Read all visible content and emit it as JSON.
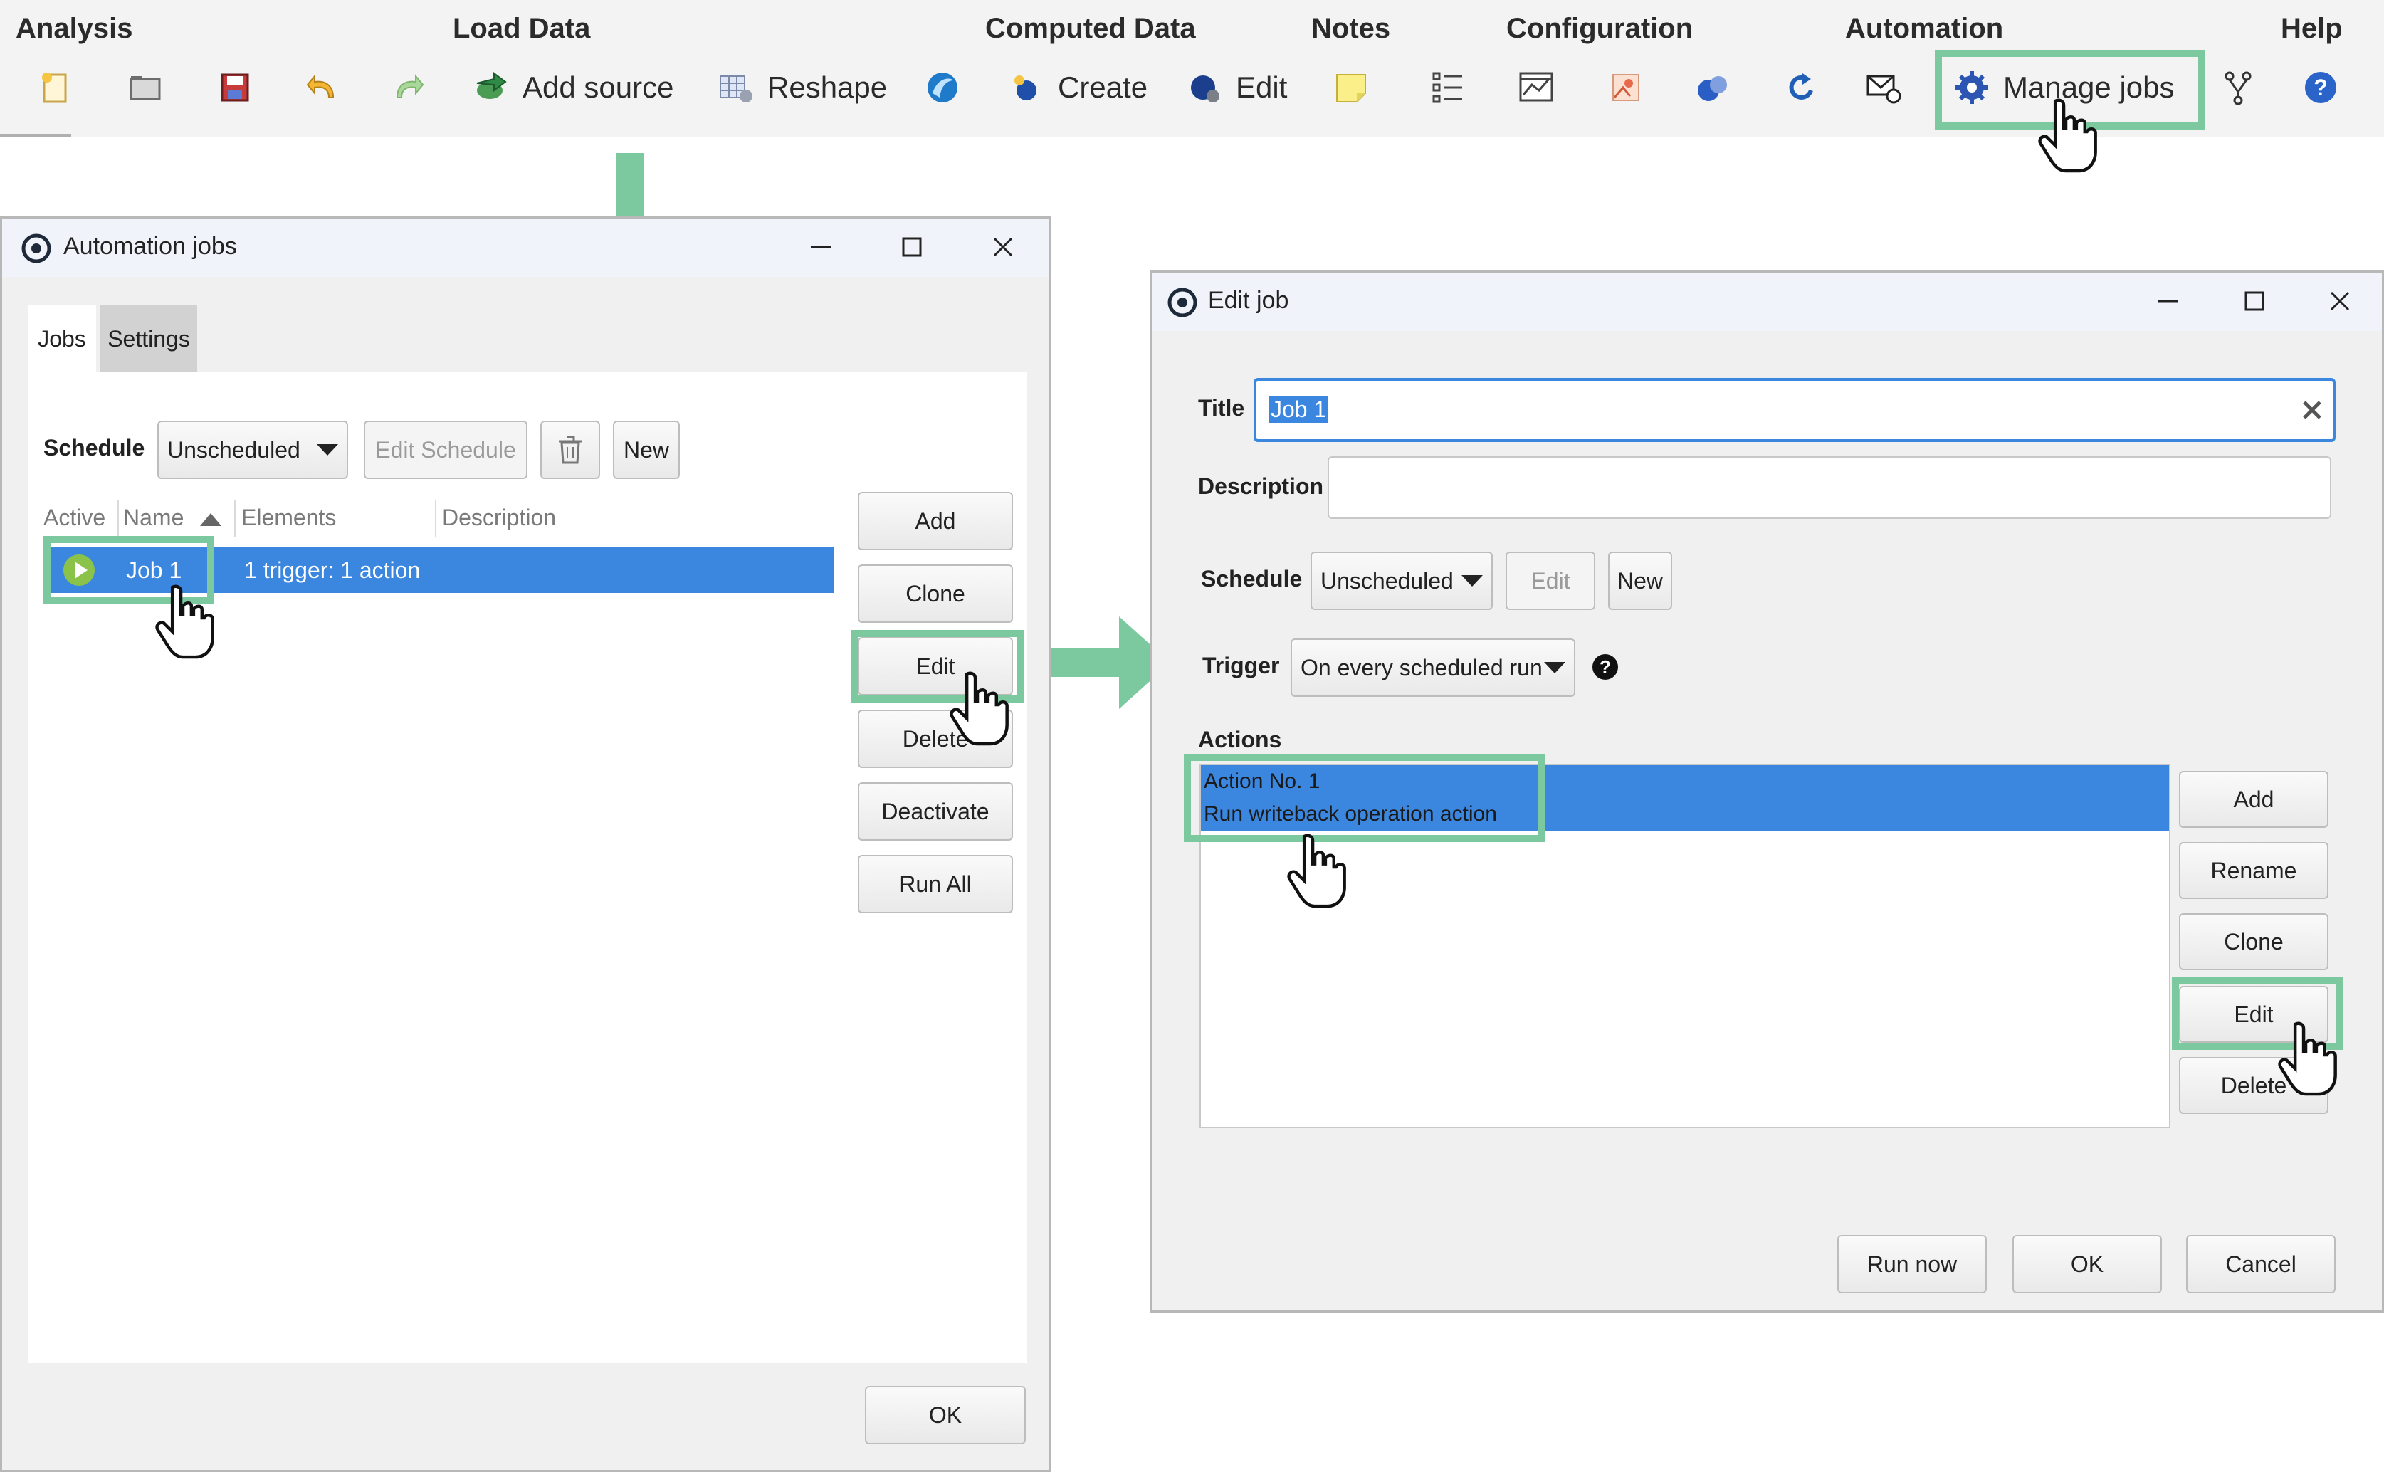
{
  "ribbon": {
    "groups": [
      "Analysis",
      "Load Data",
      "Computed Data",
      "Notes",
      "Configuration",
      "Automation",
      "Help"
    ],
    "tools": {
      "add_source": "Add source",
      "reshape": "Reshape",
      "create": "Create",
      "edit": "Edit",
      "manage_jobs": "Manage jobs"
    }
  },
  "automation_jobs": {
    "title": "Automation jobs",
    "tabs": [
      "Jobs",
      "Settings"
    ],
    "schedule_label": "Schedule",
    "schedule_value": "Unscheduled",
    "edit_schedule": "Edit Schedule",
    "new": "New",
    "columns": [
      "Active",
      "Name",
      "Elements",
      "Description"
    ],
    "rows": [
      {
        "name": "Job 1",
        "elements": "1 trigger: 1 action",
        "description": ""
      }
    ],
    "side_buttons": [
      "Add",
      "Clone",
      "Edit",
      "Delete",
      "Deactivate",
      "Run All"
    ],
    "ok": "OK"
  },
  "edit_job": {
    "title": "Edit job",
    "title_label": "Title",
    "title_value": "Job 1",
    "description_label": "Description",
    "description_value": "",
    "schedule_label": "Schedule",
    "schedule_value": "Unscheduled",
    "schedule_edit": "Edit",
    "schedule_new": "New",
    "trigger_label": "Trigger",
    "trigger_value": "On every scheduled run",
    "actions_label": "Actions",
    "actions": [
      {
        "line1": "Action No. 1",
        "line2": "Run writeback operation action"
      }
    ],
    "side_buttons": [
      "Add",
      "Rename",
      "Clone",
      "Edit",
      "Delete"
    ],
    "run_now": "Run now",
    "ok": "OK",
    "cancel": "Cancel"
  },
  "colors": {
    "highlight": "#7cc9a0",
    "selection": "#3b87e0",
    "arrow": "#7cc9a0"
  }
}
